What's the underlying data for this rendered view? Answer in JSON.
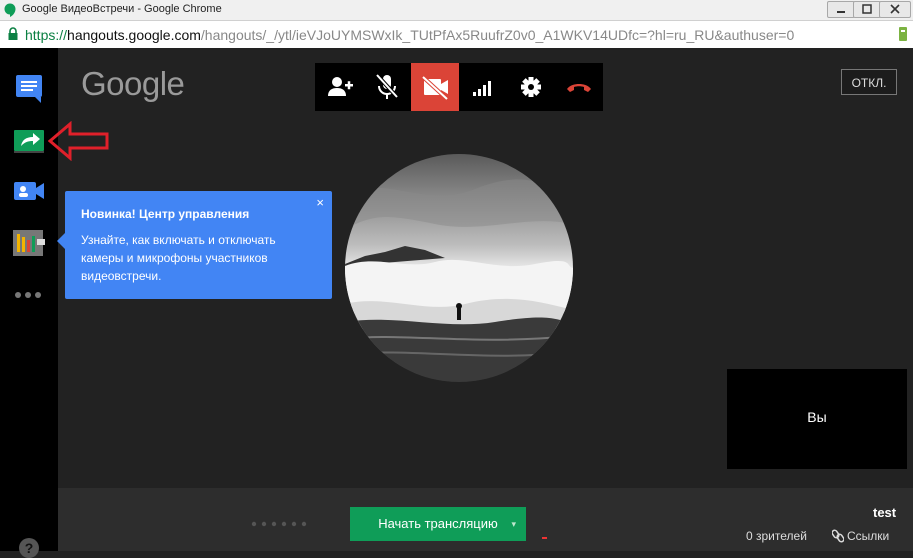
{
  "window": {
    "title": "Google ВидеоВстречи - Google Chrome"
  },
  "addressbar": {
    "scheme": "https://",
    "host": "hangouts.google.com",
    "path": "/hangouts/_/ytl/ieVJoUYMSWxIk_TUtPfAx5RuufrZ0v0_A1WKV14UDfc=?hl=ru_RU&authuser=0"
  },
  "sidebar": {
    "items": [
      {
        "icon": "chat-icon"
      },
      {
        "icon": "screenshare-icon"
      },
      {
        "icon": "video-effects-icon"
      },
      {
        "icon": "control-room-icon"
      },
      {
        "icon": "more-icon"
      }
    ],
    "help_label": "?"
  },
  "header": {
    "logo": "Google",
    "off_button": "ОТКЛ."
  },
  "toolbar": {
    "buttons": [
      "invite-person-icon",
      "mic-muted-icon",
      "camera-off-icon",
      "signal-icon",
      "settings-icon",
      "hangup-icon"
    ],
    "active": "camera-off-icon",
    "colors": {
      "active": "#db4437",
      "hangup": "#db4437"
    }
  },
  "tooltip": {
    "title": "Новинка! Центр управления",
    "text": "Узнайте, как включать и отключать камеры и микрофоны участников видеовстречи.",
    "close": "×"
  },
  "self_tile": {
    "label": "Вы"
  },
  "bottom": {
    "start_button": "Начать трансляцию",
    "start_caret": "▾",
    "name": "test",
    "viewers": "0 зрителей",
    "links": "Ссылки",
    "colors": {
      "start_button": "#0f9d58"
    }
  }
}
